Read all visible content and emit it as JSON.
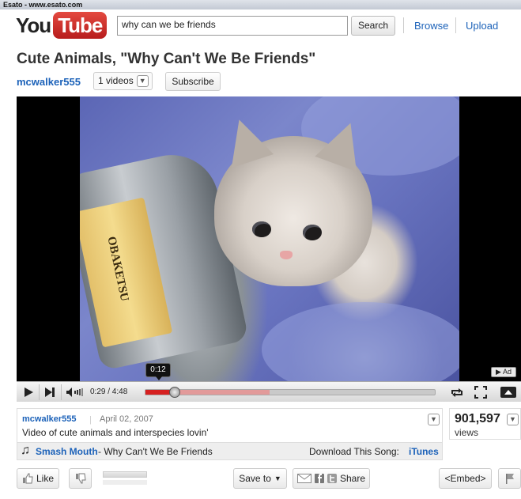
{
  "window": {
    "title": "Esato - www.esato.com"
  },
  "header": {
    "logo_you": "You",
    "logo_tube": "Tube",
    "search_value": "why can we be friends",
    "search_button": "Search",
    "nav": [
      "Browse",
      "Upload"
    ]
  },
  "video": {
    "title": "Cute Animals, \"Why Can't We Be Friends\"",
    "channel": "mcwalker555",
    "videos_count": "1 videos",
    "subscribe": "Subscribe"
  },
  "player": {
    "can_label_text": "OBAKETSU",
    "ad_badge": "▶ Ad",
    "tooltip_time": "0:12",
    "current_time": "0:29 / 4:48",
    "played_fraction": 0.1,
    "loaded_fraction": 0.43,
    "scrubber_fraction": 0.1,
    "accent_color": "#d62020",
    "icons": [
      "play-icon",
      "next-icon",
      "volume-icon",
      "loop-icon",
      "fullscreen-icon",
      "player-size-icon"
    ]
  },
  "info": {
    "user": "mcwalker555",
    "separator": "|",
    "date": "April 02, 2007",
    "description": "Video of cute animals and interspecies lovin'",
    "song_artist": "Smash Mouth",
    "song_title": "- Why Can't We Be Friends",
    "download_label": "Download This Song:",
    "itunes": "iTunes"
  },
  "views": {
    "count": "901,597",
    "label": "views"
  },
  "actions": {
    "like": "Like",
    "save_to": "Save to",
    "share": "Share",
    "embed": "<Embed>"
  }
}
